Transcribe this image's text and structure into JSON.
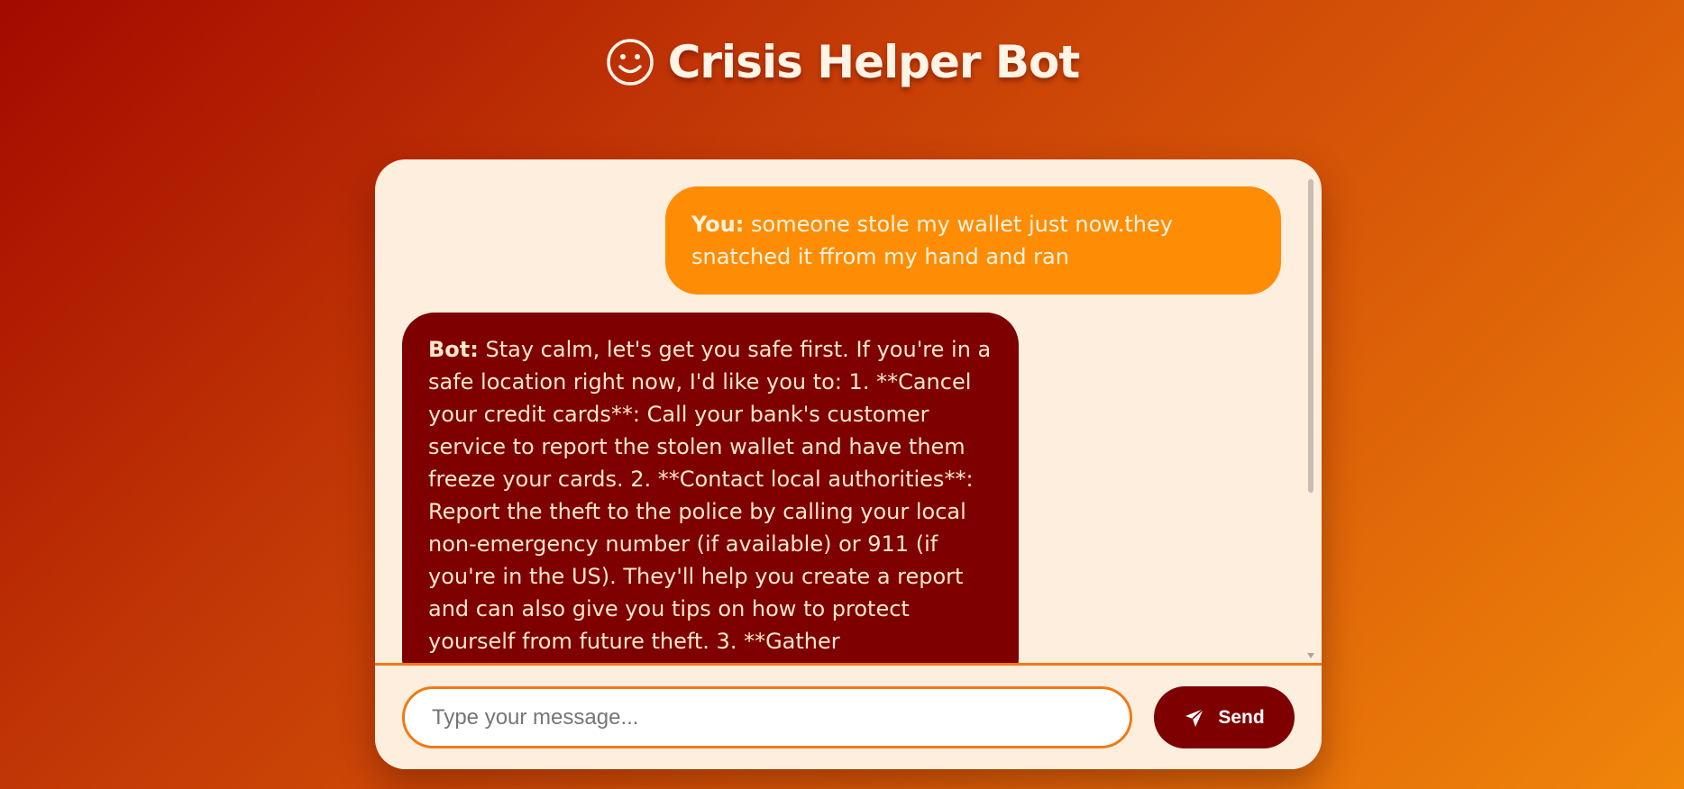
{
  "header": {
    "icon": "smiley-icon",
    "title": "Crisis Helper Bot"
  },
  "messages": [
    {
      "sender": "You:",
      "text": "someone stole my wallet just now.they snatched it ffrom my hand and ran"
    },
    {
      "sender": "Bot:",
      "text": "Stay calm, let's get you safe first. If you're in a safe location right now, I'd like you to: 1. **Cancel your credit cards**: Call your bank's customer service to report the stolen wallet and have them freeze your cards. 2. **Contact local authorities**: Report the theft to the police by calling your local non-emergency number (if available) or 911 (if you're in the US). They'll help you create a report and can also give you tips on how to protect yourself from future theft. 3. **Gather"
    }
  ],
  "input": {
    "placeholder": "Type your message...",
    "value": ""
  },
  "send": {
    "label": "Send",
    "icon": "paper-plane-icon"
  },
  "colors": {
    "background_start": "#a30a00",
    "background_end": "#f0860a",
    "card": "#fdeedd",
    "user_bubble": "#fe8c05",
    "bot_bubble": "#7e0000",
    "accent": "#f07a16"
  }
}
